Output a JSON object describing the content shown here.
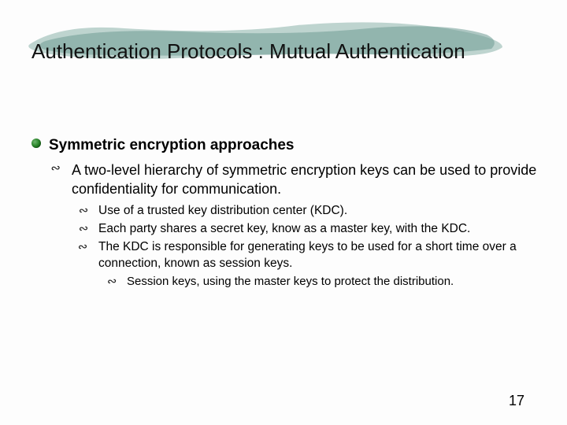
{
  "slide": {
    "title": "Authentication Protocols : Mutual Authentication",
    "page_number": "17"
  },
  "bullets": {
    "l1": "Symmetric encryption approaches",
    "l2": "A two-level hierarchy of symmetric encryption keys can be used to provide confidentiality for communication.",
    "l3a": "Use of a trusted key distribution center (KDC).",
    "l3b": "Each party shares a secret key, know as a master key, with the KDC.",
    "l3c": "The KDC is responsible for generating keys to be used for a short time over a connection, known as session keys.",
    "l4": "Session keys, using the master keys to protect the distribution."
  }
}
